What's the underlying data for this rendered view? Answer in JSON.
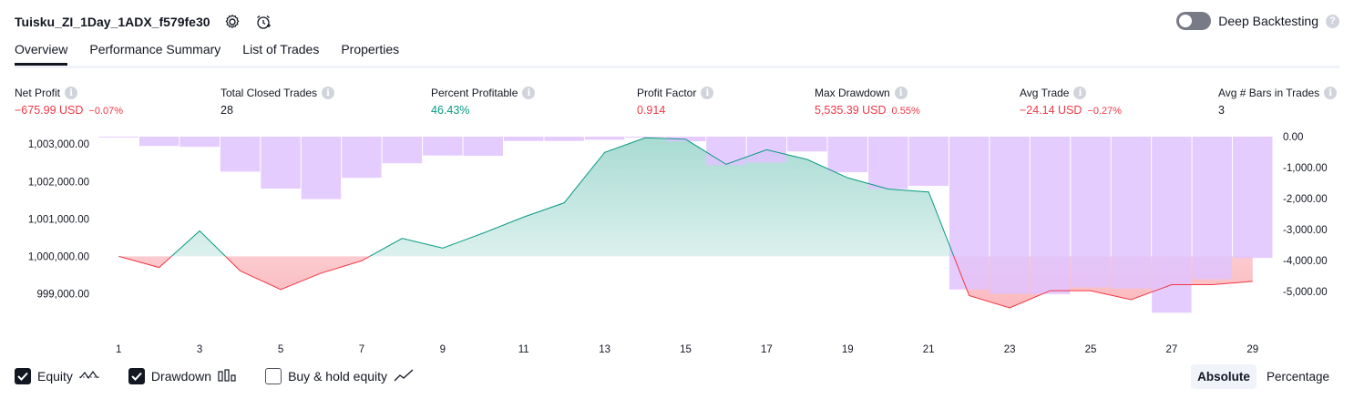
{
  "header": {
    "strategy_name": "Tuisku_ZI_1Day_1ADX_f579fe30",
    "settings_icon": "gear-icon",
    "alert_icon": "add-alert-icon"
  },
  "deep_backtesting": {
    "label": "Deep Backtesting",
    "enabled": false,
    "help": "?"
  },
  "tabs": [
    {
      "label": "Overview",
      "active": true
    },
    {
      "label": "Performance Summary",
      "active": false
    },
    {
      "label": "List of Trades",
      "active": false
    },
    {
      "label": "Properties",
      "active": false
    }
  ],
  "metrics": [
    {
      "label": "Net Profit",
      "value": "−675.99 USD",
      "sub": "−0.07%",
      "color": "#f23645"
    },
    {
      "label": "Total Closed Trades",
      "value": "28",
      "sub": "",
      "color": "#131722"
    },
    {
      "label": "Percent Profitable",
      "value": "46.43%",
      "sub": "",
      "color": "#089981"
    },
    {
      "label": "Profit Factor",
      "value": "0.914",
      "sub": "",
      "color": "#f23645"
    },
    {
      "label": "Max Drawdown",
      "value": "5,535.39 USD",
      "sub": "0.55%",
      "color": "#f23645"
    },
    {
      "label": "Avg Trade",
      "value": "−24.14 USD",
      "sub": "−0.27%",
      "color": "#f23645"
    },
    {
      "label": "Avg # Bars in Trades",
      "value": "3",
      "sub": "",
      "color": "#131722"
    }
  ],
  "info_glyph": "i",
  "chart_data": {
    "type": "line",
    "x": [
      1,
      2,
      3,
      4,
      5,
      6,
      7,
      8,
      9,
      10,
      11,
      12,
      13,
      14,
      15,
      16,
      17,
      18,
      19,
      20,
      21,
      22,
      23,
      24,
      25,
      26,
      27,
      28,
      29
    ],
    "x_tick_labels": [
      "1",
      "3",
      "5",
      "7",
      "9",
      "11",
      "13",
      "15",
      "17",
      "19",
      "21",
      "23",
      "25",
      "27",
      "29"
    ],
    "left_axis": {
      "ticks": [
        "1,003,000.00",
        "1,002,000.00",
        "1,001,000.00",
        "1,000,000.00",
        "999,000.00"
      ],
      "ylim": [
        998400,
        1003200
      ]
    },
    "right_axis": {
      "ticks": [
        "0.00",
        "-1,000.00",
        "-2,000.00",
        "-3,000.00",
        "-4,000.00",
        "-5,000.00"
      ],
      "ylim": [
        -5800,
        0
      ]
    },
    "baseline": 1000000,
    "series": [
      {
        "name": "Equity",
        "values": [
          1000000,
          999700,
          1000680,
          999610,
          999110,
          999550,
          999880,
          1000480,
          1000220,
          1000620,
          1001050,
          1001430,
          1002780,
          1003170,
          1003130,
          1002460,
          1002850,
          1002590,
          1002100,
          1001800,
          1001720,
          998950,
          998620,
          999080,
          999080,
          998840,
          999240,
          999240,
          999330
        ]
      },
      {
        "name": "Drawdown",
        "values": [
          -30,
          -300,
          -330,
          -1130,
          -1680,
          -2020,
          -1330,
          -860,
          -610,
          -620,
          -140,
          -140,
          -100,
          0,
          -150,
          -920,
          -840,
          -480,
          -1150,
          -1690,
          -1590,
          -4940,
          -5080,
          -5090,
          -4870,
          -4910,
          -5690,
          -4610,
          -3920
        ]
      }
    ],
    "legend": [
      {
        "label": "Equity",
        "checked": true,
        "icon": "equity-line-icon"
      },
      {
        "label": "Drawdown",
        "checked": true,
        "icon": "drawdown-bars-icon"
      },
      {
        "label": "Buy & hold equity",
        "checked": false,
        "icon": "buy-hold-line-icon"
      }
    ],
    "colors": {
      "profit": "#089981",
      "loss": "#f23645",
      "drawdown_bar": "#e1c3ff",
      "profit_fill": "#d9f1ea",
      "loss_fill": "#fbd7dc"
    }
  },
  "mode": {
    "absolute": "Absolute",
    "percentage": "Percentage",
    "active": "absolute"
  }
}
